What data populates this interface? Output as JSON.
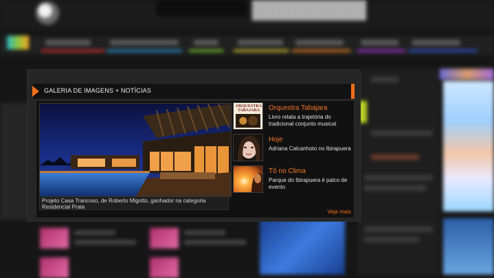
{
  "gallery": {
    "title": "GALERIA DE IMAGENS + NOTÍCIAS",
    "caption": "Projeto Casa Trancoso, de Roberto Migotto, ganhador na categoria Residencial Praia",
    "see_more": "Veja mais",
    "news": [
      {
        "title": "Orquestra Tabajara",
        "description": "Livro relata a trajetória do tradicional conjunto musical",
        "thumb_text": "ORQUESTRA TABAJARA"
      },
      {
        "title": "Hoje",
        "description": "Adriana Calcanhoto no Ibirapuera"
      },
      {
        "title": "Tô no Clima",
        "description": "Parque do Ibirapuera é palco de evento"
      }
    ]
  },
  "colors": {
    "accent": "#f26f1a",
    "modal_bg": "#262626",
    "page_bg": "#161616"
  }
}
